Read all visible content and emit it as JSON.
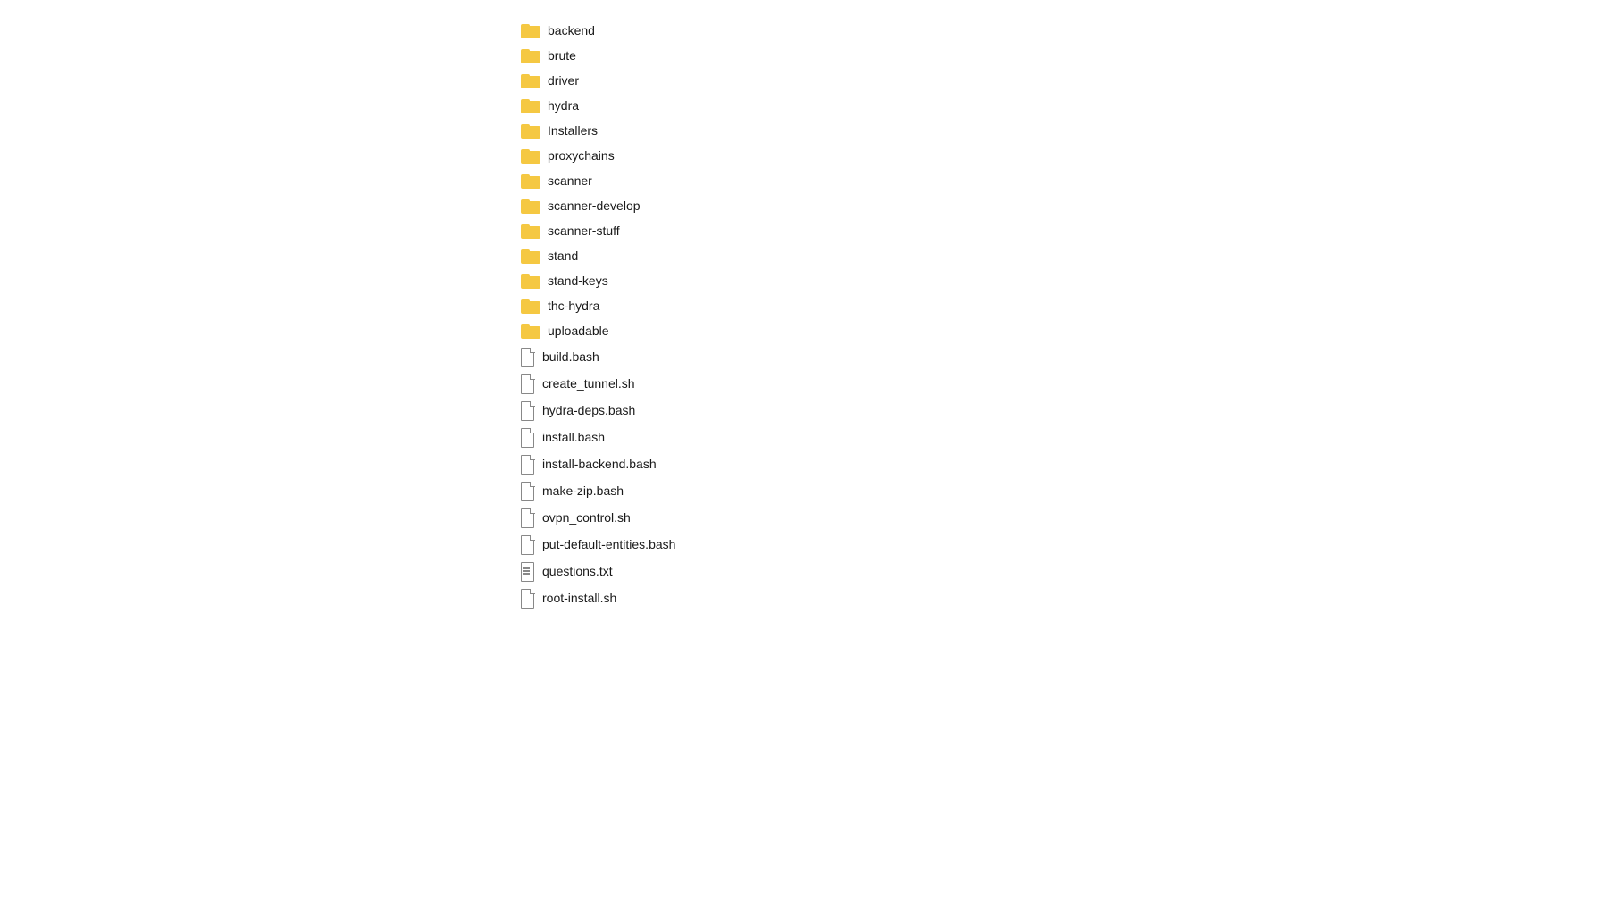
{
  "fileList": {
    "items": [
      {
        "name": "backend",
        "type": "folder"
      },
      {
        "name": "brute",
        "type": "folder"
      },
      {
        "name": "driver",
        "type": "folder"
      },
      {
        "name": "hydra",
        "type": "folder"
      },
      {
        "name": "Installers",
        "type": "folder"
      },
      {
        "name": "proxychains",
        "type": "folder"
      },
      {
        "name": "scanner",
        "type": "folder"
      },
      {
        "name": "scanner-develop",
        "type": "folder"
      },
      {
        "name": "scanner-stuff",
        "type": "folder"
      },
      {
        "name": "stand",
        "type": "folder"
      },
      {
        "name": "stand-keys",
        "type": "folder"
      },
      {
        "name": "thc-hydra",
        "type": "folder"
      },
      {
        "name": "uploadable",
        "type": "folder"
      },
      {
        "name": "build.bash",
        "type": "file"
      },
      {
        "name": "create_tunnel.sh",
        "type": "file"
      },
      {
        "name": "hydra-deps.bash",
        "type": "file"
      },
      {
        "name": "install.bash",
        "type": "file"
      },
      {
        "name": "install-backend.bash",
        "type": "file"
      },
      {
        "name": "make-zip.bash",
        "type": "file"
      },
      {
        "name": "ovpn_control.sh",
        "type": "file"
      },
      {
        "name": "put-default-entities.bash",
        "type": "file"
      },
      {
        "name": "questions.txt",
        "type": "textfile"
      },
      {
        "name": "root-install.sh",
        "type": "file"
      }
    ]
  }
}
